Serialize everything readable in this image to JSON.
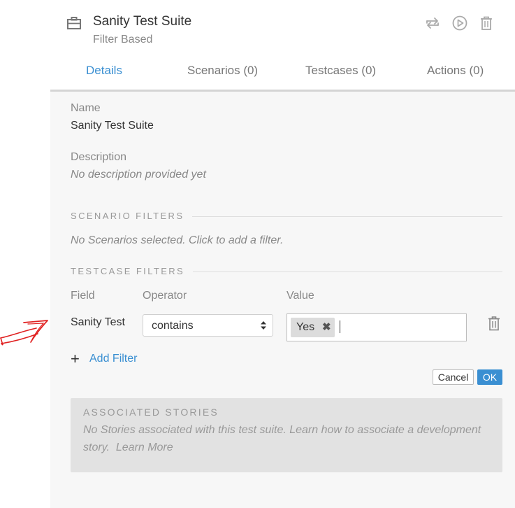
{
  "header": {
    "title": "Sanity Test Suite",
    "subtitle": "Filter Based",
    "icons": [
      "briefcase-icon",
      "sync-icon",
      "play-icon",
      "trash-icon"
    ]
  },
  "tabs": [
    {
      "label": "Details",
      "active": true
    },
    {
      "label": "Scenarios (0)",
      "active": false
    },
    {
      "label": "Testcases (0)",
      "active": false
    },
    {
      "label": "Actions (0)",
      "active": false
    }
  ],
  "details": {
    "name_label": "Name",
    "name_value": "Sanity Test Suite",
    "description_label": "Description",
    "description_value": "No description provided yet"
  },
  "scenario_filters": {
    "heading": "SCENARIO FILTERS",
    "empty_text": "No Scenarios selected. Click to add a filter."
  },
  "testcase_filters": {
    "heading": "TESTCASE FILTERS",
    "col_field": "Field",
    "col_operator": "Operator",
    "col_value": "Value",
    "row": {
      "field": "Sanity Test",
      "operator": "contains",
      "tag": "Yes"
    },
    "add_filter": "Add Filter",
    "cancel": "Cancel",
    "ok": "OK"
  },
  "stories": {
    "heading": "ASSOCIATED STORIES",
    "text": "No Stories associated with this test suite. Learn how to associate a development story.",
    "learn_more": "Learn More"
  },
  "colors": {
    "accent": "#3a8fd2",
    "panel_bg": "#f7f7f7",
    "annotation_arrow": "#e02020"
  }
}
